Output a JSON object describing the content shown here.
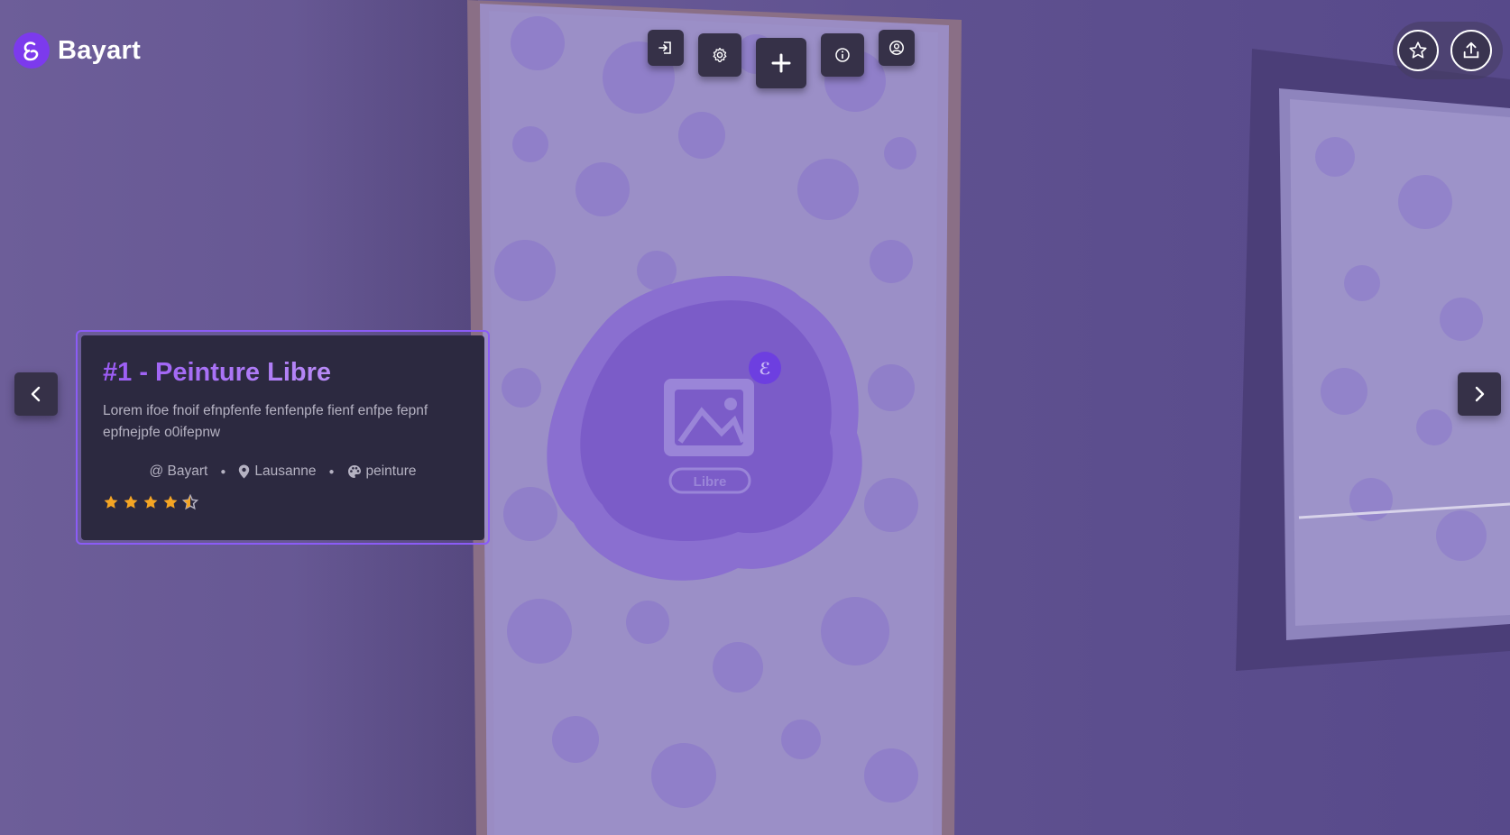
{
  "brand": {
    "name": "Bayart",
    "logo_icon": "bayart-logo-icon",
    "accent": "#7c3aed"
  },
  "toolbar": {
    "buttons": [
      {
        "name": "logout-button",
        "icon": "logout-icon"
      },
      {
        "name": "settings-button",
        "icon": "gear-icon"
      },
      {
        "name": "add-button",
        "icon": "plus-icon"
      },
      {
        "name": "info-button",
        "icon": "info-icon"
      },
      {
        "name": "profile-button",
        "icon": "user-circle-icon"
      }
    ]
  },
  "top_right": {
    "favorite_icon": "star-icon",
    "share_icon": "upload-icon"
  },
  "navigation": {
    "prev_icon": "chevron-left-icon",
    "next_icon": "chevron-right-icon"
  },
  "artwork": {
    "title": "#1 - Peinture Libre",
    "description": "Lorem ifoe fnoif efnpfenfe fenfenpfe fienf enfpe fepnf epfnejpfe o0ifepnw",
    "author": "@ Bayart",
    "location": "Lausanne",
    "category": "peinture",
    "rating": 4.5,
    "rating_max": 5,
    "star_color": "#f5a524",
    "placeholder_label": "Libre"
  }
}
